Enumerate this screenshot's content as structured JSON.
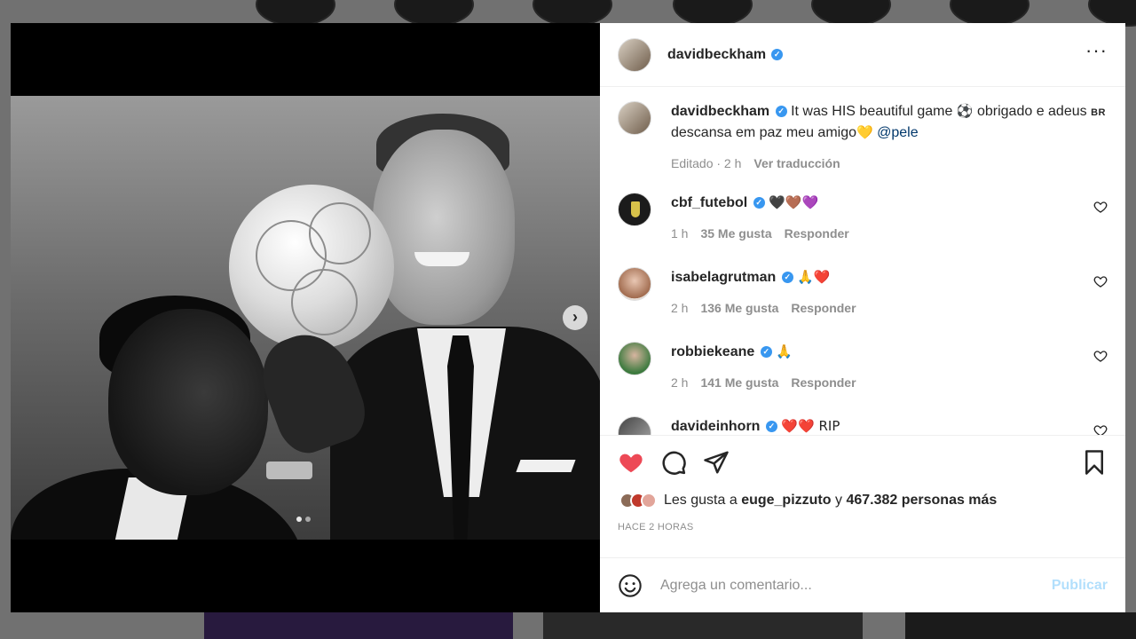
{
  "post": {
    "author": "davidbeckham",
    "caption": {
      "user": "davidbeckham",
      "text_before_ball": "It was HIS beautiful game",
      "ball_emoji": "⚽",
      "text_after_ball": "obrigado e adeus",
      "flag": "BR",
      "text_rip": "descansa em paz meu amigo",
      "heart_emoji": "💛",
      "mention": "@pele",
      "meta_edited": "Editado · 2 h",
      "meta_translate": "Ver traducción"
    },
    "comments": [
      {
        "user": "cbf_futebol",
        "text": "🖤🤎💜",
        "time": "1 h",
        "likes": "35 Me gusta",
        "reply": "Responder"
      },
      {
        "user": "isabelagrutman",
        "text": "🙏❤️",
        "time": "2 h",
        "likes": "136 Me gusta",
        "reply": "Responder"
      },
      {
        "user": "robbiekeane",
        "text": "🙏",
        "time": "2 h",
        "likes": "141 Me gusta",
        "reply": "Responder"
      },
      {
        "user": "davideinhorn",
        "text": "❤️❤️ RIP",
        "time": "",
        "likes": "",
        "reply": ""
      }
    ],
    "likes": {
      "prefix": "Les gusta a",
      "user": "euge_pizzuto",
      "connector": "y",
      "others": "467.382 personas más"
    },
    "timestamp": "HACE 2 HORAS"
  },
  "comment_box": {
    "placeholder": "Agrega un comentario...",
    "publish_label": "Publicar"
  },
  "media": {
    "carousel_count": 2,
    "carousel_index": 1
  },
  "colors": {
    "like_red": "#ed4956",
    "verified_blue": "#3897f0",
    "publish_disabled": "#b2dffc"
  }
}
